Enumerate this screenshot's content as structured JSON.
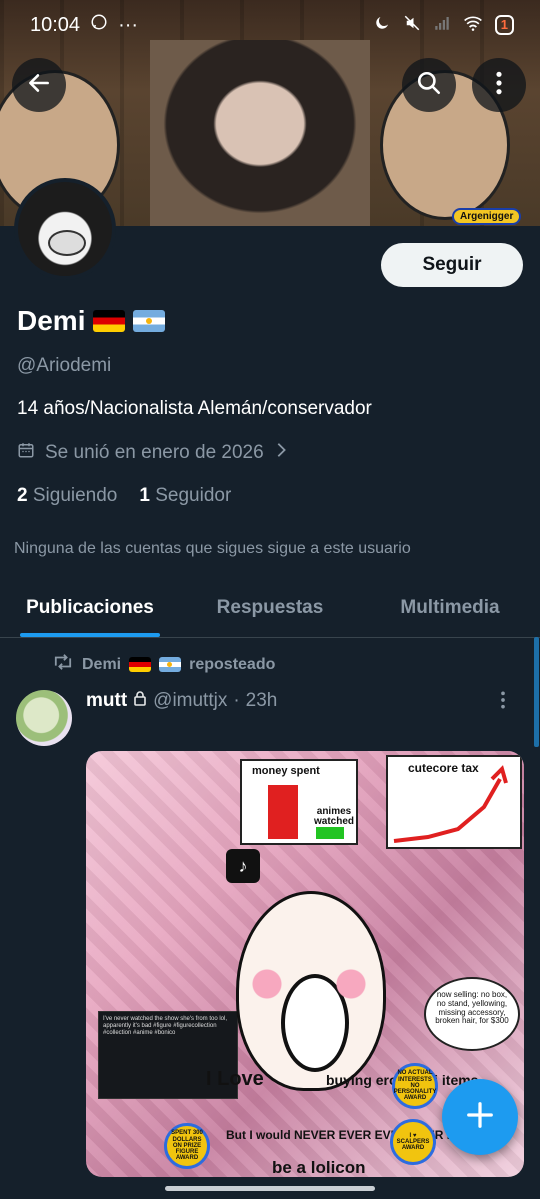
{
  "status_bar": {
    "time": "10:04",
    "battery": "1"
  },
  "banner": {
    "tag": "Argenigger"
  },
  "profile": {
    "follow_label": "Seguir",
    "name": "Demi",
    "handle": "@Ariodemi",
    "bio": "14 años/Nacionalista Alemán/conservador",
    "joined": "Se unió en enero de 2026",
    "following_count": "2",
    "following_label": "Siguiendo",
    "followers_count": "1",
    "followers_label": "Seguidor",
    "mutuals_note": "Ninguna de las cuentas que sigues sigue a este usuario"
  },
  "tabs": [
    {
      "label": "Publicaciones",
      "active": true
    },
    {
      "label": "Respuestas",
      "active": false
    },
    {
      "label": "Multimedia",
      "active": false
    }
  ],
  "post": {
    "repost_user": "Demi",
    "repost_label": "reposteado",
    "author_name": "mutt",
    "author_handle": "@imuttjx",
    "time": "23h",
    "media": {
      "money_spent": "money spent",
      "animes_watched": "animes watched",
      "cutecore_tax": "cutecore tax",
      "love": "I Love",
      "buying": "buying erotic loli items",
      "never": "But I would NEVER EVER EVER EVER NEVER",
      "be_a_lolicon": "be a lolicon",
      "bubble": "now selling: no box, no stand, yellowing, missing accessory, broken hair, for $300",
      "award1": "SPENT 300 DOLLARS ON PRIZE FIGURE AWARD",
      "award2": "NO ACTUAL INTERESTS NO PERSONALITY AWARD",
      "award3": "I ♥ SCALPERS AWARD",
      "card_text": "I've never watched the show she's from too lol, apparently it's bad #figure #figurecollection #collection #anime #bonico"
    }
  },
  "colors": {
    "background": "#15202b",
    "accent": "#1d9bf0",
    "muted_text": "#8b98a5"
  },
  "icons": [
    "back-arrow-icon",
    "search-icon",
    "more-vert-icon",
    "calendar-icon",
    "chevron-right-icon",
    "repost-icon",
    "compose-plus-icon"
  ]
}
